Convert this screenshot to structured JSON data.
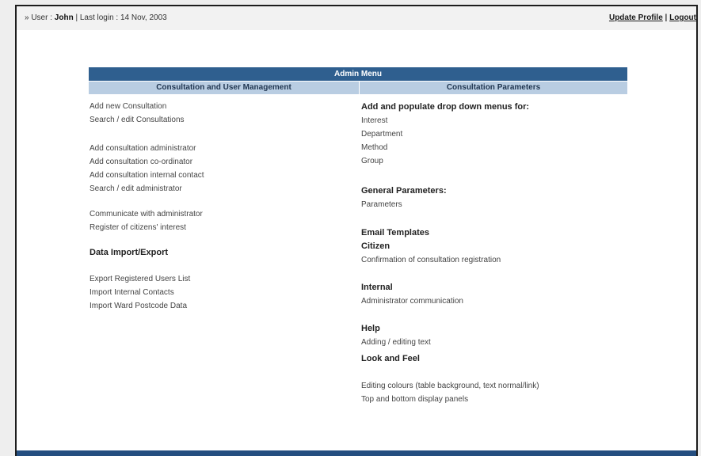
{
  "topbar": {
    "user_prefix": "» User : ",
    "user_name": "John",
    "last_login": "  | Last login : 14 Nov, 2003",
    "update_profile": "Update Profile",
    "separator": " | ",
    "logout": "Logout"
  },
  "menu": {
    "title": "Admin Menu",
    "left_header": "Consultation and User Management",
    "right_header": "Consultation Parameters"
  },
  "left": {
    "group1": [
      "Add new Consultation",
      "Search / edit Consultations"
    ],
    "group2": [
      "Add consultation administrator",
      "Add consultation co-ordinator",
      "Add consultation internal contact",
      "Search / edit administrator"
    ],
    "group3": [
      "Communicate with administrator",
      "Register of citizens' interest"
    ],
    "data_heading": "Data Import/Export",
    "group4": [
      "Export Registered Users List",
      "Import Internal Contacts",
      "Import Ward Postcode Data"
    ]
  },
  "right": {
    "dropdown_heading": "Add and populate drop down menus for:",
    "dropdown_items": [
      "Interest",
      "Department",
      "Method",
      "Group"
    ],
    "general_heading": "General Parameters:",
    "general_items": [
      "Parameters"
    ],
    "email_heading": "Email Templates",
    "citizen_heading": "Citizen",
    "citizen_items": [
      "Confirmation of consultation registration"
    ],
    "internal_heading": "Internal",
    "internal_items": [
      "Administrator communication"
    ],
    "help_heading": "Help",
    "help_items": [
      "Adding / editing text"
    ],
    "look_heading": "Look and Feel",
    "look_items": [
      "Editing colours (table background, text normal/link)",
      "Top and bottom display panels"
    ]
  }
}
